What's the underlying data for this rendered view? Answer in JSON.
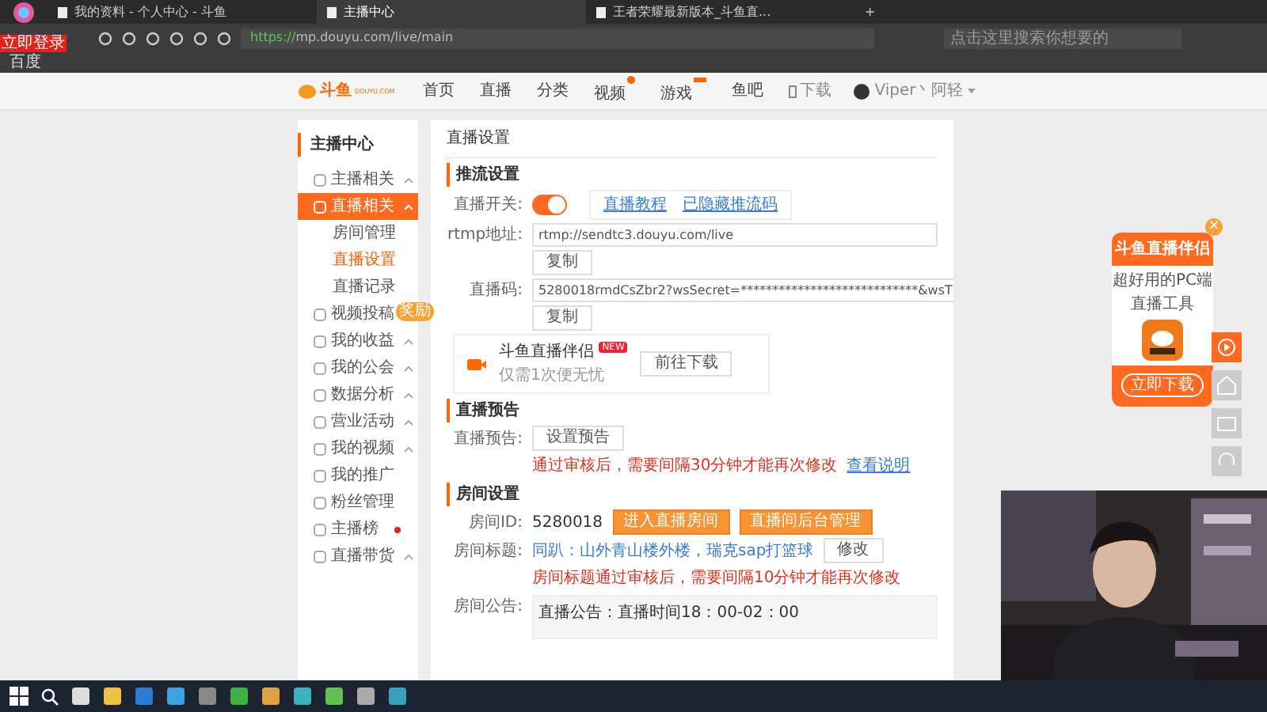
{
  "browser": {
    "avatar_badge": "立即登录",
    "tabs": [
      {
        "title": "我的资料 - 个人中心 - 斗鱼",
        "selected": false
      },
      {
        "title": "主播中心",
        "selected": true
      },
      {
        "title": "王者荣耀最新版本_斗鱼直...",
        "selected": false
      }
    ],
    "new_tab": "+",
    "url_scheme": "https://",
    "url_rest": "mp.douyu.com/live/main",
    "search_placeholder": "点击这里搜索你想要的",
    "bookmarks": [
      "百度"
    ]
  },
  "site_header": {
    "logo": "斗鱼",
    "logo_sub": "DOUYU.COM",
    "nav": [
      {
        "label": "首页",
        "kind": "plain"
      },
      {
        "label": "直播",
        "kind": "plain"
      },
      {
        "label": "分类",
        "kind": "plain"
      },
      {
        "label": "视频",
        "kind": "dot"
      },
      {
        "label": "游戏",
        "kind": "tag"
      },
      {
        "label": "鱼吧",
        "kind": "plain"
      }
    ],
    "download": "下载",
    "user": "Viper丶阿轻"
  },
  "sidebar": {
    "title": "主播中心",
    "items": [
      {
        "label": "主播相关",
        "selected": false,
        "chevron": true
      },
      {
        "label": "直播相关",
        "selected": true,
        "chevron": true,
        "children": [
          {
            "label": "房间管理",
            "selected": false
          },
          {
            "label": "直播设置",
            "selected": true
          },
          {
            "label": "直播记录",
            "selected": false
          }
        ]
      },
      {
        "label": "视频投稿",
        "selected": false,
        "chevron": false,
        "badge": "奖励"
      },
      {
        "label": "我的收益",
        "selected": false,
        "chevron": true
      },
      {
        "label": "我的公会",
        "selected": false,
        "chevron": true
      },
      {
        "label": "数据分析",
        "selected": false,
        "chevron": true
      },
      {
        "label": "营业活动",
        "selected": false,
        "chevron": true
      },
      {
        "label": "我的视频",
        "selected": false,
        "chevron": true
      },
      {
        "label": "我的推广",
        "selected": false,
        "chevron": false
      },
      {
        "label": "粉丝管理",
        "selected": false,
        "chevron": false
      },
      {
        "label": "主播榜",
        "selected": false,
        "chevron": false,
        "dot": true
      },
      {
        "label": "直播带货",
        "selected": false,
        "chevron": true
      }
    ]
  },
  "main": {
    "title": "直播设置",
    "push": {
      "heading": "推流设置",
      "switch_label": "直播开关:",
      "switch_on": true,
      "links": [
        "直播教程",
        "已隐藏推流码"
      ],
      "rtmp_label": "rtmp地址:",
      "rtmp_value": "rtmp://sendtc3.douyu.com/live",
      "copy1": "复制",
      "code_label": "直播码:",
      "code_value": "5280018rmdCsZbr2?wsSecret=****************************&wsT",
      "copy2": "复制",
      "app_name": "斗鱼直播伴侣",
      "app_tag": "NEW",
      "app_desc": "仅需1次便无忧",
      "app_button": "前往下载"
    },
    "preview": {
      "heading": "直播预告",
      "label": "直播预告:",
      "button": "设置预告",
      "note": "通过审核后，需要间隔30分钟才能再次修改",
      "link": "查看说明"
    },
    "room": {
      "heading": "房间设置",
      "id_label": "房间ID:",
      "id_value": "5280018",
      "buttons": [
        "进入直播房间",
        "直播间后台管理"
      ],
      "title_label": "房间标题:",
      "title_value": "同趴：山外青山楼外楼，瑞克sap打篮球",
      "edit": "修改",
      "title_note": "房间标题通过审核后，需要间隔10分钟才能再次修改",
      "notice_label": "房间公告:",
      "notice_value": "直播公告：直播时间18：00-02：00"
    }
  },
  "promo": {
    "title": "斗鱼直播伴侣",
    "subtitle": "超好用的PC端直播工具",
    "button": "立即下载",
    "close": "×"
  }
}
